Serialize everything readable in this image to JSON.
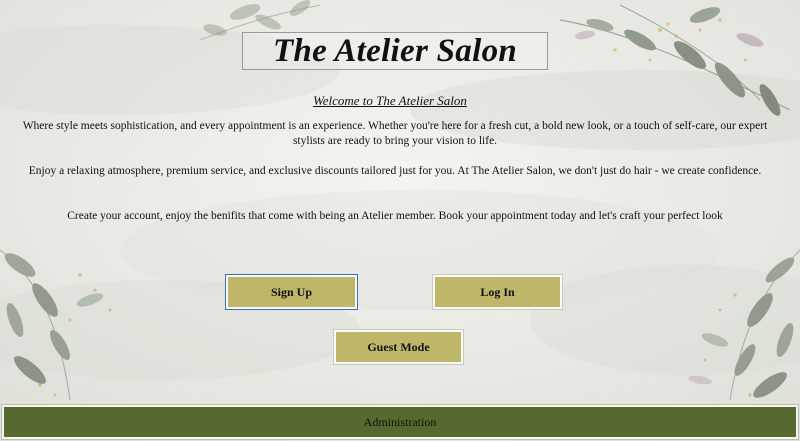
{
  "header": {
    "title": "The Atelier Salon",
    "welcome": "Welcome to The Atelier Salon"
  },
  "intro": {
    "paragraph_1": "Where style meets sophistication, and every appointment is an experience. Whether you're here for a fresh cut, a bold new look, or a touch of self-care, our expert stylists are ready to bring your vision to life.",
    "paragraph_2": "Enjoy a relaxing atmosphere, premium service, and exclusive discounts tailored just for you. At The Atelier Salon, we don't just do hair - we create confidence.",
    "paragraph_3": "Create your account, enjoy the benifits that come with being an Atelier member. Book your appointment today and let's craft your perfect look"
  },
  "actions": {
    "signup_label": "Sign Up",
    "login_label": "Log In",
    "guest_label": "Guest Mode",
    "admin_label": "Administration"
  },
  "colors": {
    "button": "#beb76a",
    "admin_bar": "#566a2f",
    "background": "#eeefea"
  },
  "decorations": {
    "background_icon": "watercolor-eucalyptus-icon"
  }
}
